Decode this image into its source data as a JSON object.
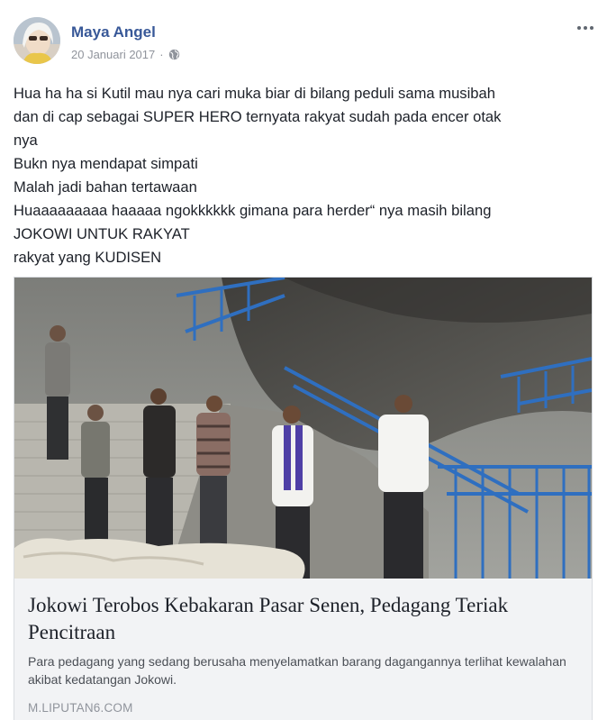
{
  "post": {
    "author": "Maya Angel",
    "date": "20 Januari 2017",
    "separator": "·",
    "privacy_icon": "globe-icon",
    "menu_icon": "more-horizontal-icon",
    "text_lines": [
      "Hua ha ha si Kutil mau nya cari muka biar di bilang peduli sama musibah",
      "dan di cap sebagai SUPER HERO ternyata rakyat sudah pada encer otak",
      "nya",
      "Bukn nya mendapat simpati",
      "Malah jadi bahan tertawaan",
      "Huaaaaaaaaa haaaaa ngokkkkkk gimana para herder“ nya masih bilang",
      "JOKOWI UNTUK RAKYAT",
      "rakyat yang KUDISEN"
    ]
  },
  "link": {
    "title": "Jokowi Terobos Kebakaran Pasar Senen, Pedagang Teriak Pencitraan",
    "description": "Para pedagang yang sedang berusaha menyelamatkan barang dagangannya terlihat kewalahan akibat kedatangan Jokowi.",
    "domain": "M.LIPUTAN6.COM"
  },
  "colors": {
    "author": "#385898",
    "meta": "#90949c",
    "caption_bg": "#f2f3f5",
    "railing_blue": "#2f6fc0"
  }
}
